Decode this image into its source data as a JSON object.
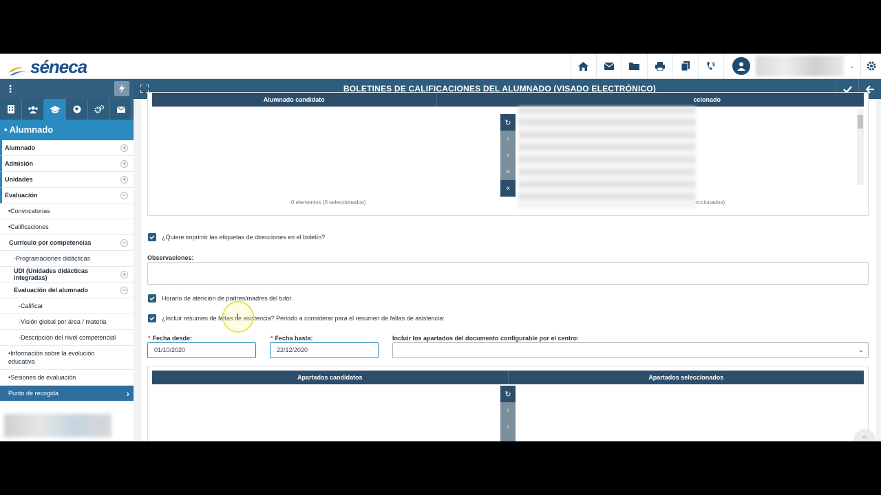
{
  "app": {
    "logo_text": "séneca",
    "page_title": "BOLETINES DE CALIFICACIONES DEL ALUMNADO (VISADO ELECTRÓNICO)"
  },
  "top_icons": [
    "home-icon",
    "mail-icon",
    "folder-icon",
    "print-icon",
    "documents-icon",
    "phone-icon"
  ],
  "sidebar": {
    "section_title": "• Alumnado",
    "tabs": [
      "building-icon",
      "users-icon",
      "graduation-cap-icon",
      "map-icon",
      "gears-icon",
      "envelope-icon"
    ],
    "items": [
      {
        "label": "Alumnado",
        "level": "l0",
        "plus": "+"
      },
      {
        "label": "Admisión",
        "level": "l0",
        "plus": "+"
      },
      {
        "label": "Unidades",
        "level": "l0",
        "plus": "+"
      },
      {
        "label": "Evaluación",
        "level": "l0",
        "plus": "−"
      },
      {
        "label": "•Convocatorias",
        "level": "l1"
      },
      {
        "label": "•Calificaciones",
        "level": "l1"
      },
      {
        "label": "Currículo por competencias",
        "level": "l2",
        "plus": "−"
      },
      {
        "label": "-Programaciones didácticas",
        "level": "l3"
      },
      {
        "label": "UDI (Unidades didácticas integradas)",
        "level": "l3b",
        "plus": "+"
      },
      {
        "label": "Evaluación del alumnado",
        "level": "l3b",
        "plus": "−"
      },
      {
        "label": "-Calificar",
        "level": "l4"
      },
      {
        "label": "-Visión global por área / materia",
        "level": "l4"
      },
      {
        "label": "-Descripción del nivel competencial",
        "level": "l4"
      },
      {
        "label": "•Información sobre la evolución educativa",
        "level": "l1",
        "tall": true
      },
      {
        "label": "•Sesiones de evaluación",
        "level": "l1"
      },
      {
        "label": "Punto de recogida",
        "level": "l1",
        "active": true
      }
    ]
  },
  "alumnado_panel": {
    "left_header": "Alumnado candidato",
    "right_header": "Alumnado seleccionado",
    "right_header_visible": "ccionado",
    "left_count": "0 elementos (0 seleccionados)",
    "right_count_visible": "eccionados)"
  },
  "form": {
    "print_labels_question": "¿Quiere imprimir las etiquetas de direcciones en el boletín?",
    "observaciones_label": "Observaciones:",
    "observaciones_value": "",
    "horario_label": "Horario de atención de padres/madres del tutor.",
    "faltas_label": "¿Incluir resumen de faltas de asistencia? Periodo a considerar para el resumen de faltas de asistencia:",
    "fecha_desde_label": "Fecha desde:",
    "fecha_desde_value": "01/10/2020",
    "fecha_hasta_label": "Fecha hasta:",
    "fecha_hasta_value": "22/12/2020",
    "apartados_label": "Incluir los apartados del documento configurable por el centro:",
    "apartados_value": "",
    "required_mark": "*"
  },
  "apartados_panel": {
    "left_header": "Apartados candidatos",
    "right_header": "Apartados seleccionados"
  },
  "mover_buttons": [
    "↻",
    "›",
    "‹",
    "»",
    "«"
  ]
}
